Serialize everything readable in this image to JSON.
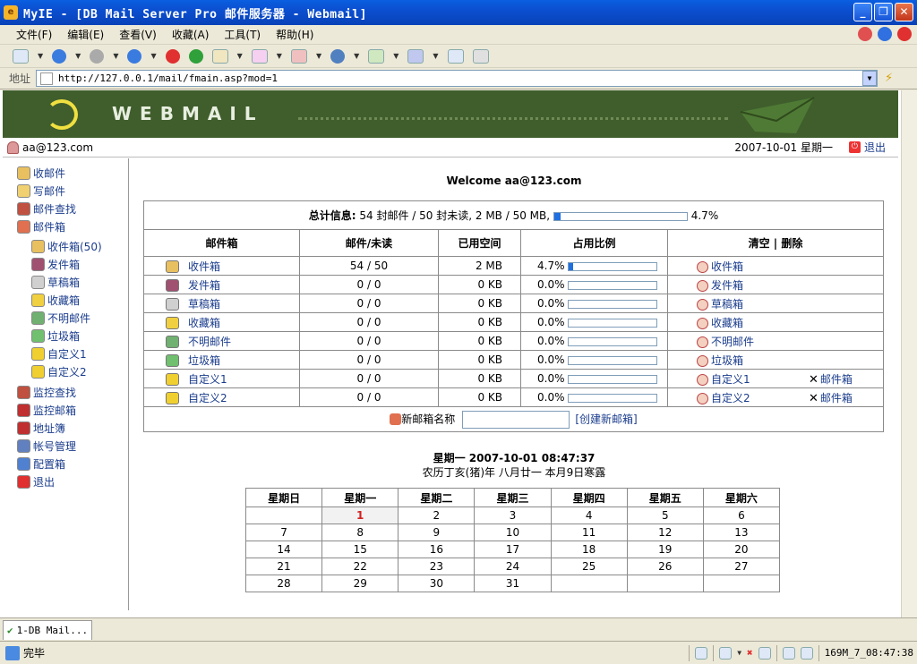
{
  "window": {
    "title": "MyIE - [DB Mail Server Pro 邮件服务器 - Webmail]"
  },
  "menu": [
    "文件(F)",
    "编辑(E)",
    "查看(V)",
    "收藏(A)",
    "工具(T)",
    "帮助(H)"
  ],
  "address": {
    "label": "地址",
    "url": "http://127.0.0.1/mail/fmain.asp?mod=1"
  },
  "banner": {
    "brand": "WEBMAIL"
  },
  "user": {
    "email": "aa@123.com",
    "date": "2007-10-01 星期一",
    "logout": "退出"
  },
  "sidebar": [
    {
      "label": "收邮件",
      "indent": 0,
      "icon": "inbox-icon",
      "color": "#e8c060"
    },
    {
      "label": "写邮件",
      "indent": 0,
      "icon": "pencil-icon",
      "color": "#f0d070"
    },
    {
      "label": "邮件查找",
      "indent": 0,
      "icon": "search-users-icon",
      "color": "#c05040"
    },
    {
      "label": "邮件箱",
      "indent": 0,
      "icon": "home-icon",
      "color": "#e07050"
    },
    {
      "label": "收件箱(50)",
      "indent": 1,
      "icon": "inbox-icon",
      "color": "#e8c060"
    },
    {
      "label": "发件箱",
      "indent": 1,
      "icon": "outbox-icon",
      "color": "#a05070"
    },
    {
      "label": "草稿箱",
      "indent": 1,
      "icon": "draft-icon",
      "color": "#d0d0d0"
    },
    {
      "label": "收藏箱",
      "indent": 1,
      "icon": "star-icon",
      "color": "#f0d040"
    },
    {
      "label": "不明邮件",
      "indent": 1,
      "icon": "unknown-mail-icon",
      "color": "#70b070"
    },
    {
      "label": "垃圾箱",
      "indent": 1,
      "icon": "trash-icon",
      "color": "#70c070"
    },
    {
      "label": "自定义1",
      "indent": 1,
      "icon": "folder-icon",
      "color": "#f0d030"
    },
    {
      "label": "自定义2",
      "indent": 1,
      "icon": "folder-icon",
      "color": "#f0d030"
    },
    {
      "label": "监控查找",
      "indent": 0,
      "icon": "monitor-search-icon",
      "color": "#c05040"
    },
    {
      "label": "监控邮箱",
      "indent": 0,
      "icon": "monitor-mailbox-icon",
      "color": "#c03030"
    },
    {
      "label": "地址簿",
      "indent": 0,
      "icon": "addressbook-icon",
      "color": "#c03030"
    },
    {
      "label": "帐号管理",
      "indent": 0,
      "icon": "account-icon",
      "color": "#6080c0"
    },
    {
      "label": "配置箱",
      "indent": 0,
      "icon": "config-icon",
      "color": "#5080d0"
    },
    {
      "label": "退出",
      "indent": 0,
      "icon": "exit-icon",
      "color": "#e03030"
    }
  ],
  "welcome": "Welcome aa@123.com",
  "summary": {
    "label": "总计信息",
    "text": "54 封邮件 / 50 封未读, 2 MB / 50 MB,",
    "pct_text": "4.7%",
    "pct": 4.7
  },
  "headers": {
    "mailbox": "邮件箱",
    "count": "邮件/未读",
    "space": "已用空间",
    "ratio": "占用比例",
    "actions": "清空 | 删除"
  },
  "mailboxes": [
    {
      "name": "收件箱",
      "count": "54 / 50",
      "size": "2 MB",
      "pct_text": "4.7%",
      "pct": 4.7,
      "clear": "收件箱",
      "del": "",
      "color": "#e8c060"
    },
    {
      "name": "发件箱",
      "count": "0 / 0",
      "size": "0 KB",
      "pct_text": "0.0%",
      "pct": 0,
      "clear": "发件箱",
      "del": "",
      "color": "#a05070"
    },
    {
      "name": "草稿箱",
      "count": "0 / 0",
      "size": "0 KB",
      "pct_text": "0.0%",
      "pct": 0,
      "clear": "草稿箱",
      "del": "",
      "color": "#d0d0d0"
    },
    {
      "name": "收藏箱",
      "count": "0 / 0",
      "size": "0 KB",
      "pct_text": "0.0%",
      "pct": 0,
      "clear": "收藏箱",
      "del": "",
      "color": "#f0d040"
    },
    {
      "name": "不明邮件",
      "count": "0 / 0",
      "size": "0 KB",
      "pct_text": "0.0%",
      "pct": 0,
      "clear": "不明邮件",
      "del": "",
      "color": "#70b070"
    },
    {
      "name": "垃圾箱",
      "count": "0 / 0",
      "size": "0 KB",
      "pct_text": "0.0%",
      "pct": 0,
      "clear": "垃圾箱",
      "del": "",
      "color": "#70c070"
    },
    {
      "name": "自定义1",
      "count": "0 / 0",
      "size": "0 KB",
      "pct_text": "0.0%",
      "pct": 0,
      "clear": "自定义1",
      "del": "邮件箱",
      "color": "#f0d030"
    },
    {
      "name": "自定义2",
      "count": "0 / 0",
      "size": "0 KB",
      "pct_text": "0.0%",
      "pct": 0,
      "clear": "自定义2",
      "del": "邮件箱",
      "color": "#f0d030"
    }
  ],
  "new_mailbox": {
    "label": "新邮箱名称",
    "create": "[创建新邮箱]"
  },
  "clock": "星期一  2007-10-01 08:47:37",
  "lunar": "农历丁亥(猪)年  八月廿一 本月9日寒露",
  "calendar": {
    "days": [
      "星期日",
      "星期一",
      "星期二",
      "星期三",
      "星期四",
      "星期五",
      "星期六"
    ],
    "weeks": [
      [
        "",
        "1",
        "2",
        "3",
        "4",
        "5",
        "6"
      ],
      [
        "7",
        "8",
        "9",
        "10",
        "11",
        "12",
        "13"
      ],
      [
        "14",
        "15",
        "16",
        "17",
        "18",
        "19",
        "20"
      ],
      [
        "21",
        "22",
        "23",
        "24",
        "25",
        "26",
        "27"
      ],
      [
        "28",
        "29",
        "30",
        "31",
        "",
        "",
        ""
      ]
    ],
    "today": "1"
  },
  "tab": {
    "label": "1-DB Mail..."
  },
  "status": {
    "text": "完毕",
    "right": "169M_7_08:47:38"
  }
}
